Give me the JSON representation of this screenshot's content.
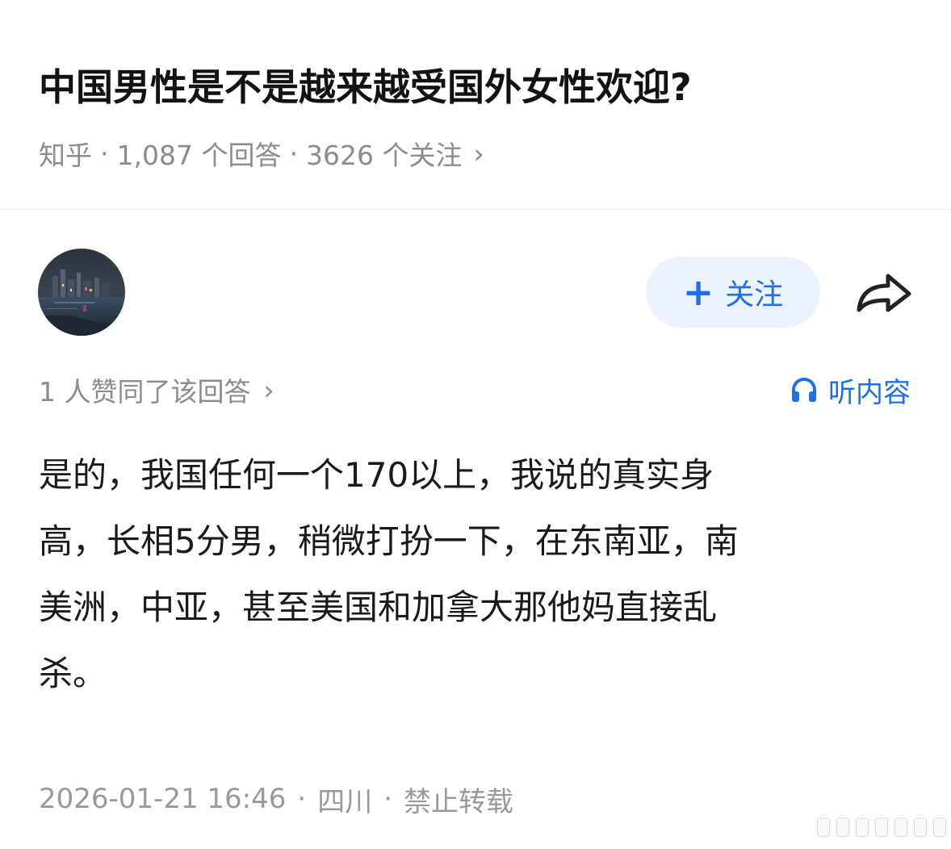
{
  "question": {
    "title": "中国男性是不是越来越受国外女性欢迎?",
    "meta": {
      "site": "知乎",
      "separator": "·",
      "answers_count": "1,087 个回答",
      "followers_count": "3626 个关注",
      "chevron": "›"
    }
  },
  "answer_header": {
    "avatar_icon": "night-city-avatar",
    "follow_button": {
      "icon": "plus-icon",
      "plus_glyph": "+",
      "label": "关注"
    },
    "share_icon": "share-arrow-icon"
  },
  "likes_line": {
    "text": "1 人赞同了该回答",
    "chevron": "›"
  },
  "listen": {
    "icon": "headphones-icon",
    "label": "听内容"
  },
  "answer": {
    "body": "是的，我国任何一个170以上，我说的真实身\n高，长相5分男，稍微打扮一下，在东南亚，南\n美洲，中亚，甚至美国和加拿大那他妈直接乱\n杀。"
  },
  "footer": {
    "datetime": "2026-01-21 16:46",
    "separator": "·",
    "location": "四川",
    "repost_policy": "禁止转载"
  },
  "colors": {
    "accent_blue": "#1e6fe8",
    "follow_bg": "#ebf2fd",
    "meta_gray": "#8c8c8c"
  }
}
